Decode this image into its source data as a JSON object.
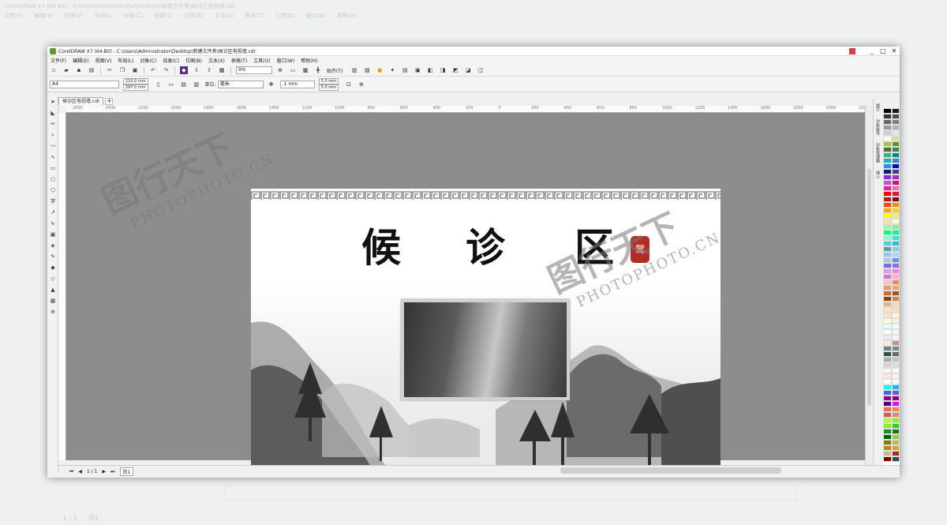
{
  "app": {
    "window_title": "CorelDRAW X7 (64-Bit) - C:\\Users\\Administrator\\Desktop\\新建文件夹\\候诊区电视墙.cdr",
    "menu": [
      "文件(F)",
      "编辑(E)",
      "视图(V)",
      "布局(L)",
      "对象(C)",
      "效果(C)",
      "位图(B)",
      "文本(X)",
      "表格(T)",
      "工具(O)",
      "窗口(W)",
      "帮助(H)"
    ],
    "window_buttons": [
      "_",
      "□",
      "✕"
    ]
  },
  "toolbar": {
    "zoom": "9%",
    "snap_label": "贴齐(T)"
  },
  "property_bar": {
    "page_size": "A4",
    "width": "210.0 mm",
    "height": "297.0 mm",
    "units_label": "单位:",
    "units": "毫米",
    "nudge": ".1 mm",
    "dup_x": "5.0 mm",
    "dup_y": "5.0 mm"
  },
  "document": {
    "tab_name": "候诊区电视墙.cdr",
    "add_tab": "+"
  },
  "ruler": {
    "ticks": [
      "2600",
      "2400",
      "2200",
      "2000",
      "1800",
      "1600",
      "1400",
      "1200",
      "1000",
      "800",
      "600",
      "400",
      "200",
      "0",
      "200",
      "400",
      "600",
      "800",
      "1000",
      "1200",
      "1400",
      "1600",
      "1800",
      "2000",
      "2200"
    ]
  },
  "artwork": {
    "title_chars": [
      "候",
      "诊",
      "区"
    ],
    "seal_text": "鹭",
    "watermark_brand": "图行天下",
    "watermark_url": "PHOTOPHOTO.CN"
  },
  "dock_tabs": [
    "提示",
    "对象属性",
    "对象管理器",
    "插入"
  ],
  "status": {
    "page_counter": "1 / 1",
    "page_tab": "页1"
  },
  "palette_colors": [
    "#000000",
    "#1a1a1a",
    "#333333",
    "#4d4d4d",
    "#666666",
    "#808080",
    "#999999",
    "#b3b3b3",
    "#cccccc",
    "#e6e6e6",
    "#ffffff",
    "#c8e6a0",
    "#a4c639",
    "#6b8e23",
    "#556b2f",
    "#2e8b57",
    "#3cb371",
    "#008b8b",
    "#20b2aa",
    "#4682b4",
    "#1e90ff",
    "#0000cd",
    "#191970",
    "#483d8b",
    "#8a2be2",
    "#9932cc",
    "#ba55d3",
    "#c71585",
    "#ff1493",
    "#ff69b4",
    "#ff0000",
    "#dc143c",
    "#b22222",
    "#8b0000",
    "#ff4500",
    "#ff8c00",
    "#ffa500",
    "#ffd700",
    "#ffff00",
    "#f0e68c",
    "#eee8aa",
    "#fafad2",
    "#98fb98",
    "#90ee90",
    "#00ff7f",
    "#00fa9a",
    "#7fffd4",
    "#40e0d0",
    "#48d1cc",
    "#00ced1",
    "#5f9ea0",
    "#87ceeb",
    "#87cefa",
    "#add8e6",
    "#b0c4de",
    "#6495ed",
    "#7b68ee",
    "#9370db",
    "#dda0dd",
    "#ee82ee",
    "#da70d6",
    "#ffb6c1",
    "#ffc0cb",
    "#fa8072",
    "#e9967a",
    "#f4a460",
    "#d2691e",
    "#a0522d",
    "#8b4513",
    "#cd853f",
    "#deb887",
    "#f5deb3",
    "#ffe4b5",
    "#ffdead",
    "#ffe4c4",
    "#fff8dc",
    "#fffacd",
    "#f5f5dc",
    "#e0ffff",
    "#f0fff0",
    "#f5fffa",
    "#f0f8ff",
    "#e6e6fa",
    "#fff0f5",
    "#faebd7",
    "#bc8f8f",
    "#708090",
    "#778899",
    "#2f4f4f",
    "#696969",
    "#a9a9a9",
    "#c0c0c0",
    "#d3d3d3",
    "#dcdcdc",
    "#f5f5f5",
    "#fffafa",
    "#ffe4e1",
    "#fdf5e6",
    "#fffff0",
    "#f0ffff",
    "#00ffff",
    "#00bfff",
    "#4169e1",
    "#6a5acd",
    "#8b008b",
    "#800080",
    "#4b0082",
    "#ff00ff",
    "#ff6347",
    "#ff7f50",
    "#cd5c5c",
    "#f08080",
    "#adff2f",
    "#7fff00",
    "#7cfc00",
    "#32cd32",
    "#228b22",
    "#008000",
    "#006400",
    "#9acd32",
    "#808000",
    "#bdb76b",
    "#b8860b",
    "#daa520",
    "#d2b48c",
    "#a52a2a",
    "#800000",
    "#2f4f4f"
  ]
}
